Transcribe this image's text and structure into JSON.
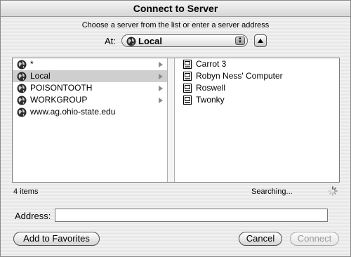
{
  "window": {
    "title": "Connect to Server"
  },
  "prompt": "Choose a server from the list or enter a server address",
  "at": {
    "label": "At:",
    "value": "Local"
  },
  "browser": {
    "column1": [
      {
        "label": "*",
        "has_children": true,
        "selected": false
      },
      {
        "label": "Local",
        "has_children": true,
        "selected": true
      },
      {
        "label": "POISONTOOTH",
        "has_children": true,
        "selected": false
      },
      {
        "label": "WORKGROUP",
        "has_children": true,
        "selected": false
      },
      {
        "label": "www.ag.ohio-state.edu",
        "has_children": false,
        "selected": false
      }
    ],
    "column2": [
      {
        "label": "Carrot 3"
      },
      {
        "label": "Robyn Ness' Computer"
      },
      {
        "label": "Roswell"
      },
      {
        "label": "Twonky"
      }
    ]
  },
  "status": {
    "items": "4 items",
    "searching": "Searching..."
  },
  "address": {
    "label": "Address:",
    "value": ""
  },
  "buttons": {
    "add_to_favorites": "Add to Favorites",
    "cancel": "Cancel",
    "connect": "Connect"
  }
}
